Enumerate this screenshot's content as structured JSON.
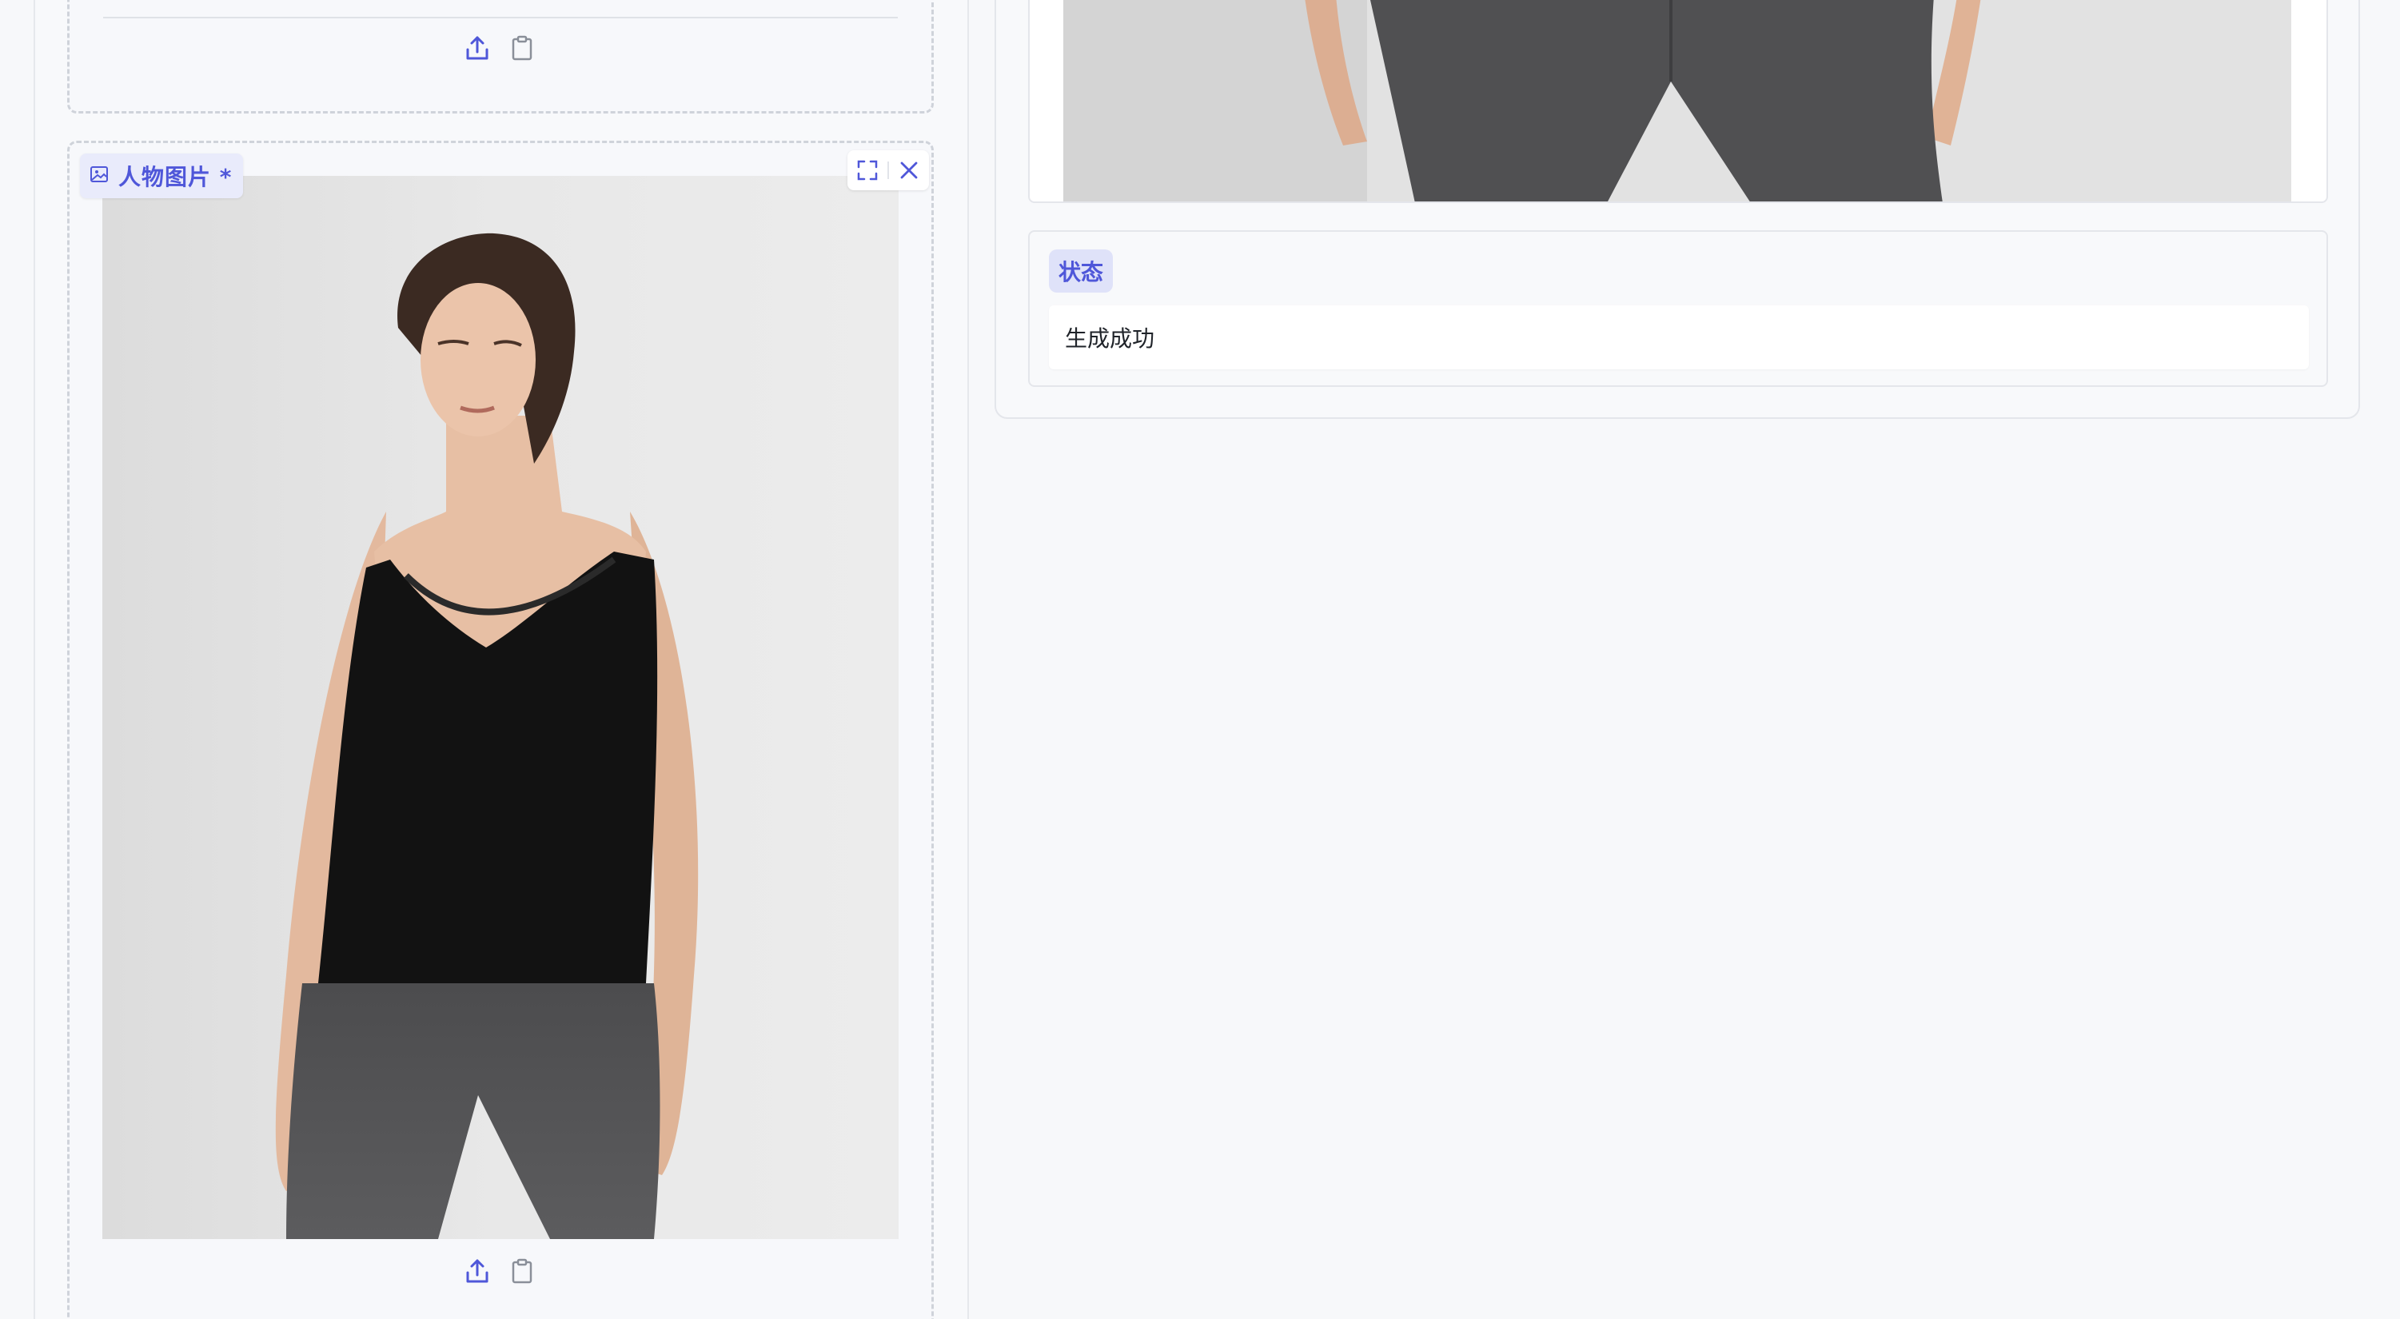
{
  "left_panel": {
    "upload_box_1": {
      "upload_icon": "upload-icon",
      "clipboard_icon": "clipboard-icon"
    },
    "person_image": {
      "label_icon": "image-icon",
      "label": "人物图片 *",
      "fullscreen_icon": "fullscreen-icon",
      "close_icon": "close-icon",
      "upload_icon": "upload-icon",
      "clipboard_icon": "clipboard-icon"
    }
  },
  "right_panel": {
    "output_image_icon": "image",
    "status": {
      "label": "状态",
      "value": "生成成功"
    }
  },
  "colors": {
    "accent": "#4f57d9",
    "label_bg": "#e9ebfb",
    "background": "#f7f8fa",
    "border_dashed": "#cfd3da"
  }
}
